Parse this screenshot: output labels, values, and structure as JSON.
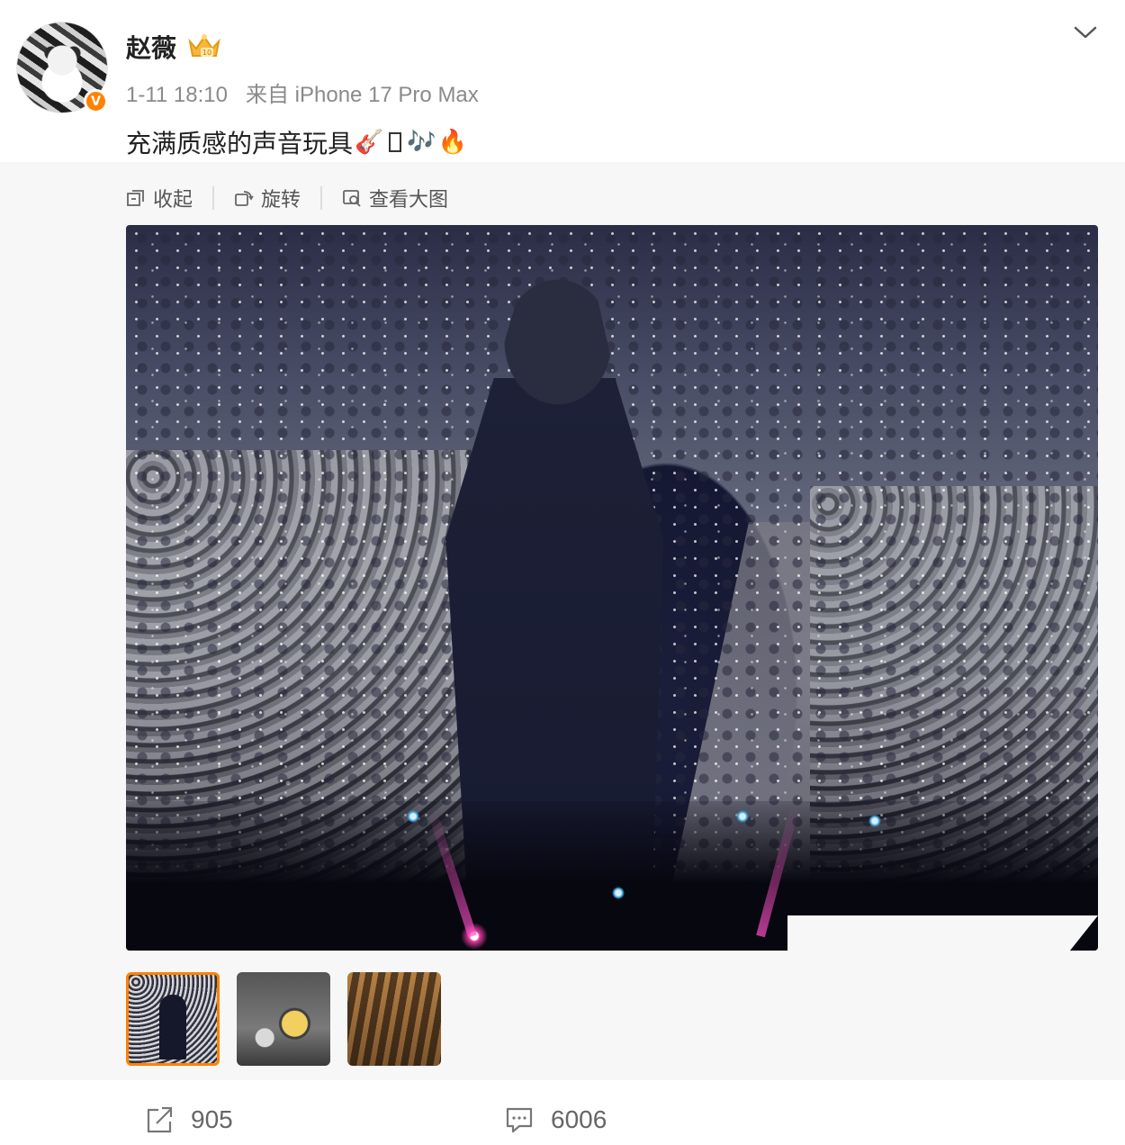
{
  "post": {
    "author": "赵薇",
    "time": "1-11 18:10",
    "source": "来自 iPhone 17 Pro Max",
    "text": "充满质感的声音玩具",
    "emojis": [
      "🎸",
      "🎶",
      "🔥"
    ],
    "verified_mark": "V",
    "level_badge": "10"
  },
  "toolbar": {
    "collapse_label": "收起",
    "rotate_label": "旋转",
    "view_large_label": "查看大图"
  },
  "gallery": {
    "thumbnail_count": 3,
    "selected_index": 0
  },
  "footer": {
    "share_count": "905",
    "comment_count": "6006"
  },
  "colors": {
    "accent": "#ff8200",
    "muted_text": "#8a8a8a",
    "content_background": "#f7f7f7"
  },
  "icons": [
    "chevron-down-icon",
    "collapse-icon",
    "rotate-icon",
    "view-large-icon",
    "share-icon",
    "comment-icon",
    "crown-icon"
  ]
}
